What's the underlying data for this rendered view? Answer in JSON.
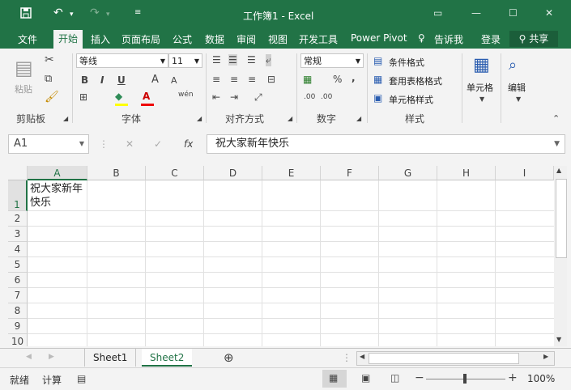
{
  "window": {
    "title": "工作簿1 - Excel"
  },
  "quick_access": {
    "save_icon": "save-icon",
    "undo_icon": "undo-icon",
    "redo_icon": "redo-icon",
    "customize_icon": "customize-qat-icon"
  },
  "window_controls": {
    "ribbon_display": "▭",
    "minimize": "—",
    "maximize": "☐",
    "close": "✕"
  },
  "tabs": [
    "文件",
    "开始",
    "插入",
    "页面布局",
    "公式",
    "数据",
    "审阅",
    "视图",
    "开发工具",
    "Power Pivot"
  ],
  "active_tab": "开始",
  "tell_me": "告诉我",
  "signin": "登录",
  "share": "共享",
  "ribbon": {
    "clipboard": {
      "paste": "粘贴",
      "label": "剪贴板"
    },
    "font": {
      "family": "等线",
      "size": "11",
      "label": "字体",
      "bold": "B",
      "italic": "I",
      "underline": "U",
      "grow": "A",
      "shrink": "A",
      "phonetic": "wén"
    },
    "alignment": {
      "label": "对齐方式"
    },
    "number": {
      "format": "常规",
      "label": "数字",
      "percent": "%",
      "comma": ",",
      "inc_decimal": ".00",
      "dec_decimal": ".00"
    },
    "styles": {
      "conditional": "条件格式",
      "table": "套用表格格式",
      "cell_styles": "单元格样式",
      "label": "样式"
    },
    "cells": {
      "label": "单元格"
    },
    "editing": {
      "label": "编辑"
    }
  },
  "formula_bar": {
    "name_box": "A1",
    "cancel": "✕",
    "enter": "✓",
    "fx": "fx",
    "content": "祝大家新年快乐"
  },
  "columns": [
    "A",
    "B",
    "C",
    "D",
    "E",
    "F",
    "G",
    "H",
    "I"
  ],
  "rows": [
    "1",
    "2",
    "3",
    "4",
    "5",
    "6",
    "7",
    "8",
    "9",
    "10"
  ],
  "cells": {
    "A1": "祝大家新年快乐"
  },
  "sheets": [
    "Sheet1",
    "Sheet2"
  ],
  "active_sheet": "Sheet2",
  "status": {
    "ready": "就绪",
    "calculate": "计算",
    "zoom": "100%"
  },
  "colors": {
    "accent": "#217346",
    "share_bg": "#1b5e3a"
  }
}
